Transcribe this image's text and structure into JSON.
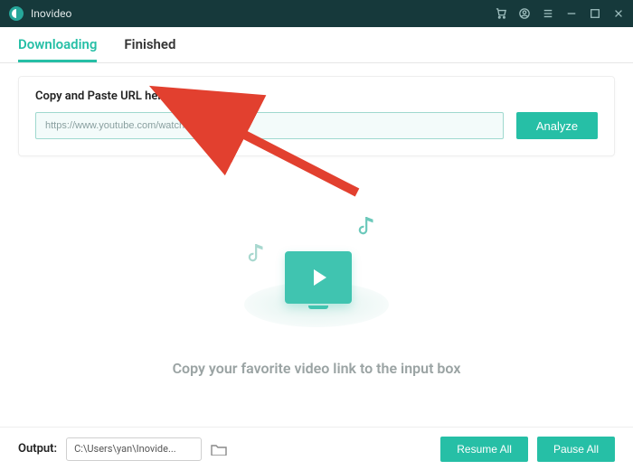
{
  "app": {
    "name": "Inovideo"
  },
  "tabs": {
    "downloading": "Downloading",
    "finished": "Finished",
    "active": "downloading"
  },
  "url_section": {
    "label": "Copy and Paste URL here:",
    "input_value": "https://www.youtube.com/watch?v=        Pnvw",
    "analyze_label": "Analyze"
  },
  "empty_state": {
    "message": "Copy your favorite video link to the input box"
  },
  "footer": {
    "output_label": "Output:",
    "output_path": "C:\\Users\\yan\\Inovide...",
    "resume_label": "Resume All",
    "pause_label": "Pause All"
  },
  "icons": {
    "cart": "cart-icon",
    "account": "account-icon",
    "menu": "menu-icon",
    "minimize": "minimize-icon",
    "maximize": "maximize-icon",
    "close": "close-icon",
    "folder": "folder-icon"
  },
  "colors": {
    "accent": "#26bfa6",
    "titlebar": "#16393b"
  }
}
